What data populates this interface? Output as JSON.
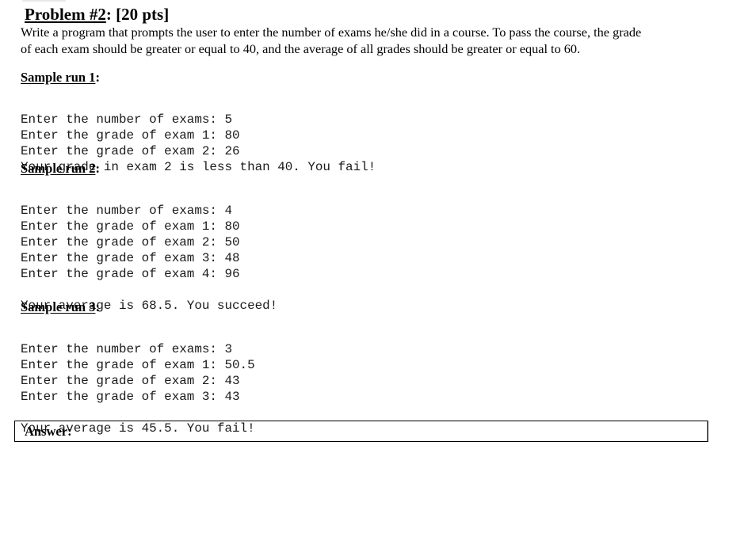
{
  "problem": {
    "title_underlined": "Problem #2",
    "title_rest": ": [20 pts]",
    "description_lines": [
      "Write a program that prompts the user to enter the number of exams he/she did in a course. To pass the course, the grade",
      "of each exam should be greater or equal to 40, and the average of all grades should be greater or equal to 60."
    ]
  },
  "sample_runs": [
    {
      "heading_underlined": "Sample run 1",
      "heading_suffix": ":",
      "lines": [
        "Enter the number of exams: 5",
        "Enter the grade of exam 1: 80",
        "Enter the grade of exam 2: 26",
        "Your grade in exam 2 is less than 40. You fail!"
      ]
    },
    {
      "heading_underlined": "Sample run 2",
      "heading_suffix": ":",
      "lines": [
        "Enter the number of exams: 4",
        "Enter the grade of exam 1: 80",
        "Enter the grade of exam 2: 50",
        "Enter the grade of exam 3: 48",
        "Enter the grade of exam 4: 96",
        "",
        "Your average is 68.5. You succeed!"
      ]
    },
    {
      "heading_underlined": "Sample run 3",
      "heading_suffix": ":",
      "lines": [
        "Enter the number of exams: 3",
        "Enter the grade of exam 1: 50.5",
        "Enter the grade of exam 2: 43",
        "Enter the grade of exam 3: 43",
        "",
        "Your average is 45.5. You fail!"
      ]
    }
  ],
  "answer": {
    "label": "Answer:"
  }
}
